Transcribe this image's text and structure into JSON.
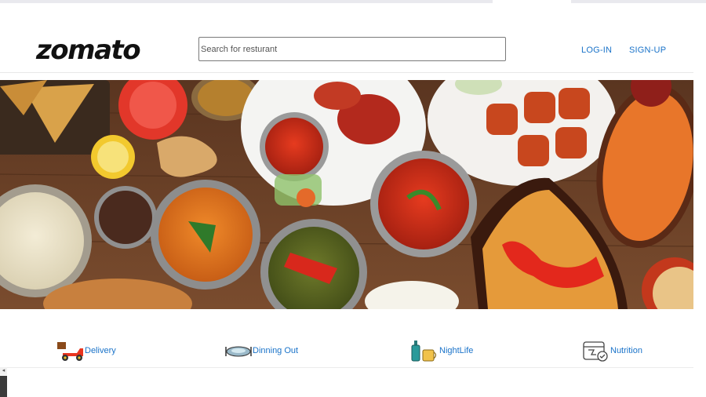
{
  "header": {
    "logo_text": "zomato",
    "search": {
      "placeholder": "Search for resturant",
      "value": ""
    },
    "nav": {
      "login": "LOG-IN",
      "signup": "SIGN-UP"
    }
  },
  "hero": {
    "image_alt": "spread of indian dishes"
  },
  "categories": [
    {
      "label": "Delivery",
      "icon": "delivery-scooter-icon"
    },
    {
      "label": "Dinning Out",
      "icon": "dining-plate-icon"
    },
    {
      "label": "NightLife",
      "icon": "drinks-icon"
    },
    {
      "label": "Nutrition",
      "icon": "nutrition-icon"
    }
  ],
  "colors": {
    "link": "#1a73c9",
    "logo": "#111111",
    "hero_wood": "#6b4128"
  }
}
